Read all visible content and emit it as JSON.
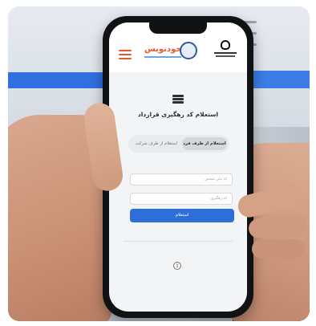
{
  "screen": {
    "title": "استعلام کد رهگیری قرارداد",
    "tabs": [
      {
        "label": "استعلام از طرف فرد",
        "active": true
      },
      {
        "label": "استعلام از طرف شرکت",
        "active": false
      }
    ],
    "fields": [
      {
        "placeholder": "کد ملی شخص"
      },
      {
        "placeholder": "کد رهگیری"
      }
    ],
    "submit_label": "استعلام",
    "info_icon": "i",
    "header": {
      "site_logo_text": "خودنویس",
      "menu_icon": "hamburger-icon",
      "gov_emblem": "iran-emblem-icon"
    }
  },
  "colors": {
    "accent": "#2d6ed8",
    "brand": "#e8552f"
  }
}
